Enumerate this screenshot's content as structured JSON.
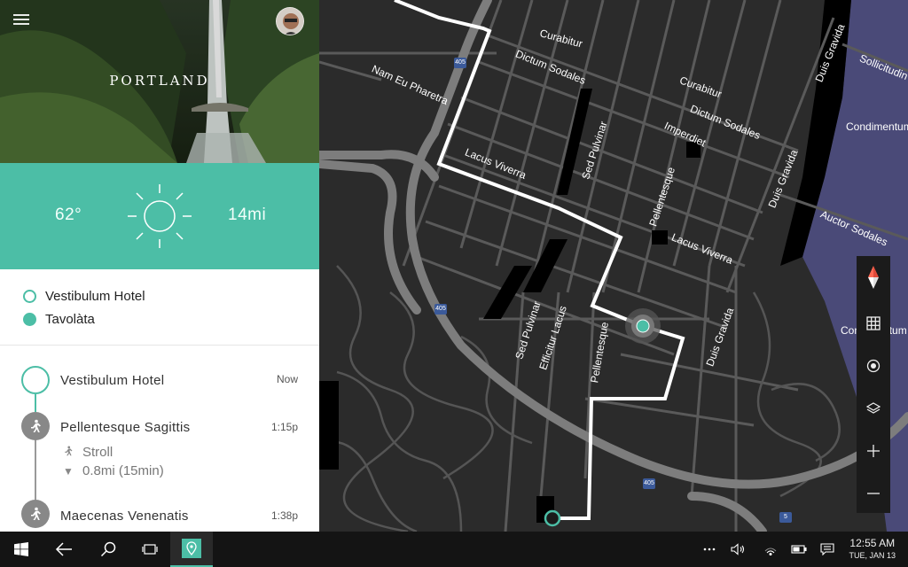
{
  "header": {
    "city": "PORTLAND"
  },
  "weather": {
    "temperature": "62°",
    "distance": "14mi",
    "icon": "sun-icon"
  },
  "places": [
    {
      "label": "Vestibulum Hotel",
      "marker": "hollow"
    },
    {
      "label": "Tavolàta",
      "marker": "filled"
    }
  ],
  "itinerary": [
    {
      "title": "Vestibulum Hotel",
      "time": "Now"
    },
    {
      "title": "Pellentesque Sagittis",
      "time": "1:15p",
      "mode": "Stroll",
      "detail": "0.8mi (15min)"
    },
    {
      "title": "Maecenas Venenatis",
      "time": "1:38p"
    }
  ],
  "map": {
    "streets": [
      "Curabitur",
      "Dictum Sodales",
      "Curabitur",
      "Dictum Sodales",
      "Imperdiet",
      "Nam Eu Pharetra",
      "Lacus Viverra",
      "Sed Pulvinar",
      "Pellentesque",
      "Lacus Viverra",
      "Duis Gravida",
      "Duis Gravida",
      "Sollicitudin",
      "Condimentum",
      "Auctor Sodales",
      "Condimentum",
      "Sed Pulvinar",
      "Efficitur Lacus",
      "Pellentesque",
      "Duis Gravida"
    ],
    "shields": [
      "405",
      "405",
      "405",
      "5"
    ],
    "route_color": "#ffffff",
    "accent": "#4cbea6",
    "water_color": "#4a4a78"
  },
  "map_tools": [
    "compass-icon",
    "grid-icon",
    "locate-icon",
    "layers-icon",
    "zoom-in-icon",
    "zoom-out-icon"
  ],
  "taskbar": {
    "time": "12:55 AM",
    "date": "TUE, JAN 13"
  }
}
